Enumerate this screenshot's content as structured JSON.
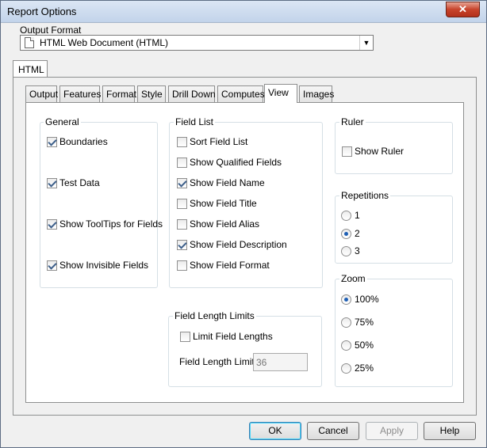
{
  "window": {
    "title": "Report Options",
    "close_glyph": "✕"
  },
  "output_format": {
    "label": "Output Format",
    "value": "HTML Web Document (HTML)",
    "dropdown_glyph": "▼",
    "icon": "document-icon"
  },
  "outer_tab": {
    "label": "HTML"
  },
  "tabs": [
    {
      "label": "Output"
    },
    {
      "label": "Features"
    },
    {
      "label": "Format"
    },
    {
      "label": "Style"
    },
    {
      "label": "Drill Down"
    },
    {
      "label": "Computes"
    },
    {
      "label": "View",
      "active": true
    },
    {
      "label": "Images"
    }
  ],
  "general": {
    "title": "General",
    "items": [
      {
        "label": "Boundaries",
        "checked": true
      },
      {
        "label": "Test Data",
        "checked": true
      },
      {
        "label": "Show ToolTips for Fields",
        "checked": true
      },
      {
        "label": "Show Invisible Fields",
        "checked": true
      }
    ]
  },
  "field_list": {
    "title": "Field List",
    "items": [
      {
        "label": "Sort Field List",
        "checked": false
      },
      {
        "label": "Show Qualified Fields",
        "checked": false
      },
      {
        "label": "Show Field Name",
        "checked": true
      },
      {
        "label": "Show Field Title",
        "checked": false
      },
      {
        "label": "Show Field Alias",
        "checked": false
      },
      {
        "label": "Show Field Description",
        "checked": true
      },
      {
        "label": "Show Field Format",
        "checked": false
      }
    ]
  },
  "field_length_limits": {
    "title": "Field Length Limits",
    "checkbox_label": "Limit Field Lengths",
    "checked": false,
    "limit_label": "Field Length Limit",
    "limit_value": "36"
  },
  "ruler": {
    "title": "Ruler",
    "checkbox_label": "Show Ruler",
    "checked": false
  },
  "repetitions": {
    "title": "Repetitions",
    "options": [
      {
        "label": "1",
        "selected": false
      },
      {
        "label": "2",
        "selected": true
      },
      {
        "label": "3",
        "selected": false
      }
    ]
  },
  "zoom": {
    "title": "Zoom",
    "options": [
      {
        "label": "100%",
        "selected": true
      },
      {
        "label": "75%",
        "selected": false
      },
      {
        "label": "50%",
        "selected": false
      },
      {
        "label": "25%",
        "selected": false
      }
    ]
  },
  "buttons": {
    "ok": "OK",
    "cancel": "Cancel",
    "apply": "Apply",
    "help": "Help"
  }
}
